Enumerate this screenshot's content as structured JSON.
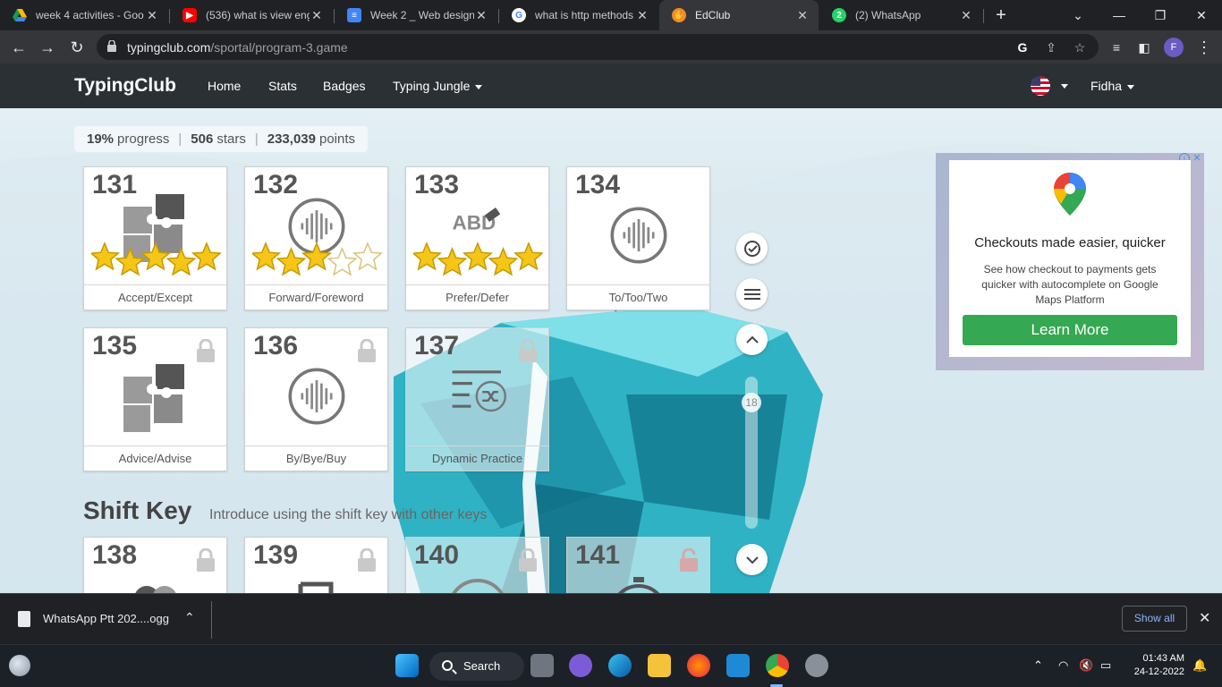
{
  "browser": {
    "tabs": [
      {
        "title": "week 4 activities - Goo",
        "favicon": "google-drive-icon",
        "color": "#1fa463"
      },
      {
        "title": "(536) what is view eng",
        "favicon": "youtube-icon",
        "color": "#ff0000"
      },
      {
        "title": "Week 2 _ Web designi",
        "favicon": "google-docs-icon",
        "color": "#4285f4"
      },
      {
        "title": "what is http methods",
        "favicon": "google-icon",
        "color": "#ffffff"
      },
      {
        "title": "EdClub",
        "favicon": "edclub-icon",
        "color": "#f28c28",
        "active": true
      },
      {
        "title": "(2) WhatsApp",
        "favicon": "whatsapp-icon",
        "color": "#25d366"
      }
    ],
    "url_host": "typingclub.com",
    "url_path": "/sportal/program-3.game",
    "profile_initial": "F"
  },
  "site": {
    "logo": "TypingClub",
    "nav": [
      "Home",
      "Stats",
      "Badges",
      "Typing Jungle"
    ],
    "user": "Fidha"
  },
  "progress": {
    "percent": "19%",
    "percent_label": "progress",
    "stars": "506",
    "stars_label": "stars",
    "points": "233,039",
    "points_label": "points"
  },
  "lessons": [
    {
      "num": "131",
      "label": "Accept/Except",
      "icon": "puzzle-icon",
      "stars": 5,
      "locked": false
    },
    {
      "num": "132",
      "label": "Forward/Foreword",
      "icon": "audio-wave-icon",
      "stars": 3,
      "locked": false
    },
    {
      "num": "133",
      "label": "Prefer/Defer",
      "icon": "abc-eraser-icon",
      "stars": 5,
      "locked": false
    },
    {
      "num": "134",
      "label": "To/Too/Two",
      "icon": "audio-wave-icon",
      "stars": 0,
      "locked": false
    },
    {
      "num": "135",
      "label": "Advice/Advise",
      "icon": "puzzle-icon",
      "stars": 0,
      "locked": true
    },
    {
      "num": "136",
      "label": "By/Bye/Buy",
      "icon": "audio-wave-icon",
      "stars": 0,
      "locked": true
    },
    {
      "num": "137",
      "label": "Dynamic Practice",
      "icon": "shuffle-list-icon",
      "stars": 0,
      "locked": true
    },
    {
      "num": "138",
      "label": "",
      "icon": "puzzle-icon",
      "stars": 0,
      "locked": true
    },
    {
      "num": "139",
      "label": "",
      "icon": "keyboard-icon",
      "stars": 0,
      "locked": true
    },
    {
      "num": "140",
      "label": "",
      "icon": "gauge-icon",
      "stars": 0,
      "locked": true
    },
    {
      "num": "141",
      "label": "",
      "icon": "stopwatch-icon",
      "stars": 0,
      "locked": true
    }
  ],
  "section": {
    "title": "Shift Key",
    "subtitle": "Introduce using the shift key with other keys"
  },
  "side_controls": {
    "scroll_number": "18"
  },
  "ad": {
    "title": "Checkouts made easier, quicker",
    "text": "See how checkout to payments gets quicker with autocomplete on Google Maps Platform",
    "button": "Learn More",
    "icon": "google-maps-pin-icon"
  },
  "download": {
    "file": "WhatsApp Ptt 202....ogg",
    "show_all": "Show all"
  },
  "taskbar": {
    "search": "Search",
    "time": "01:43 AM",
    "date": "24-12-2022"
  }
}
